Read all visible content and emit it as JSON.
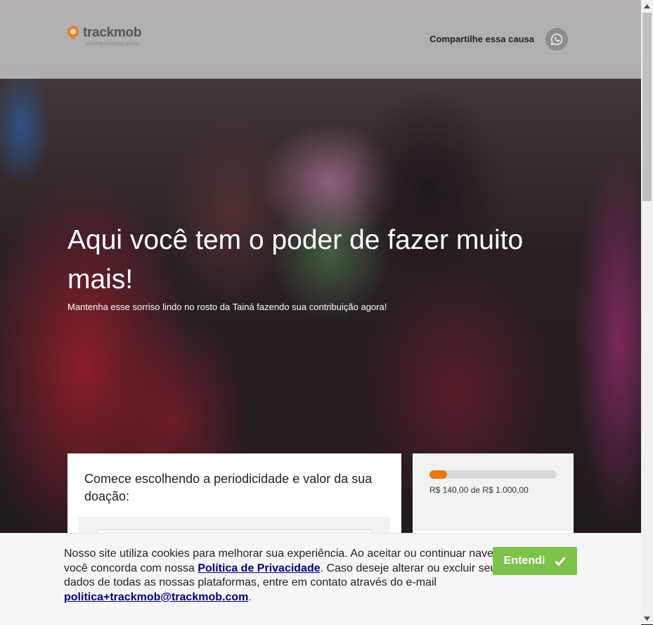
{
  "header": {
    "logo_text": "trackmob",
    "logo_tagline": "tracking everyday giving",
    "share_label": "Compartilhe essa causa",
    "share_icon": "whatsapp-icon"
  },
  "hero": {
    "title": "Aqui você tem o poder de fazer muito mais!",
    "subtitle": "Mantenha esse sorriso lindo no rosto da Tainá fazendo sua contribuição agora!"
  },
  "donation_card": {
    "title": "Comece escolhendo a periodicidade e valor da sua doação:"
  },
  "progress_card": {
    "progress_fraction": 0.14,
    "progress_text": "R$ 140,00 de R$ 1.000,00",
    "accent": "#e8770e"
  },
  "cookie": {
    "text_1": "Nosso site utiliza cookies para melhorar sua experiência. Ao aceitar ou continuar navegando, você concorda com nossa ",
    "policy_link": "Política de Privacidade",
    "text_2": ". Caso deseje alterar ou excluir seus dados de todas as nossas plataformas, entre em contato através do e-mail ",
    "email_link": "politica+trackmob@trackmob.com",
    "text_3": ".",
    "button_label": "Entendi",
    "button_color": "#7ec24a"
  }
}
